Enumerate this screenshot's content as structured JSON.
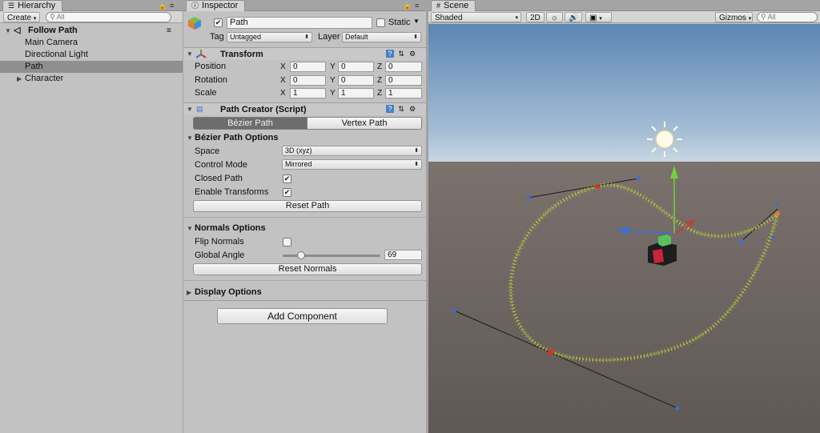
{
  "hierarchy": {
    "tab": "Hierarchy",
    "create": "Create",
    "search_placeholder": "All",
    "root": "Follow Path",
    "items": [
      "Main Camera",
      "Directional Light",
      "Path",
      "Character"
    ]
  },
  "inspector": {
    "tab": "Inspector",
    "object_name": "Path",
    "static_label": "Static",
    "tag_label": "Tag",
    "tag_value": "Untagged",
    "layer_label": "Layer",
    "layer_value": "Default",
    "transform": {
      "title": "Transform",
      "rows": [
        {
          "label": "Position",
          "x": "0",
          "y": "0",
          "z": "0"
        },
        {
          "label": "Rotation",
          "x": "0",
          "y": "0",
          "z": "0"
        },
        {
          "label": "Scale",
          "x": "1",
          "y": "1",
          "z": "1"
        }
      ],
      "axes": [
        "X",
        "Y",
        "Z"
      ]
    },
    "path_creator": {
      "title": "Path Creator (Script)",
      "tabs": [
        "Bézier Path",
        "Vertex Path"
      ],
      "active_tab": "Bézier Path",
      "bezier_options_title": "Bézier Path Options",
      "space_label": "Space",
      "space_value": "3D (xyz)",
      "control_mode_label": "Control Mode",
      "control_mode_value": "Mirrored",
      "closed_path_label": "Closed Path",
      "closed_path": true,
      "enable_transforms_label": "Enable Transforms",
      "enable_transforms": true,
      "reset_path": "Reset Path",
      "normals_title": "Normals Options",
      "flip_normals_label": "Flip Normals",
      "flip_normals": false,
      "global_angle_label": "Global Angle",
      "global_angle_value": "69",
      "global_angle_fraction": 0.19,
      "reset_normals": "Reset Normals",
      "display_options": "Display Options"
    },
    "add_component": "Add Component"
  },
  "scene": {
    "tab": "Scene",
    "shading": "Shaded",
    "mode_2d": "2D",
    "gizmos": "Gizmos",
    "search_placeholder": "All",
    "colors": {
      "sky_top": "#5b86b4",
      "horizon": "#c9d6e3",
      "ground": "#6b6360",
      "path": "#8fd13a",
      "path_ticks": "#e0c040",
      "handle_line": "#1a1a1a",
      "handle_point": "#3b6fd6",
      "anchor_point": "#d4341c"
    }
  }
}
